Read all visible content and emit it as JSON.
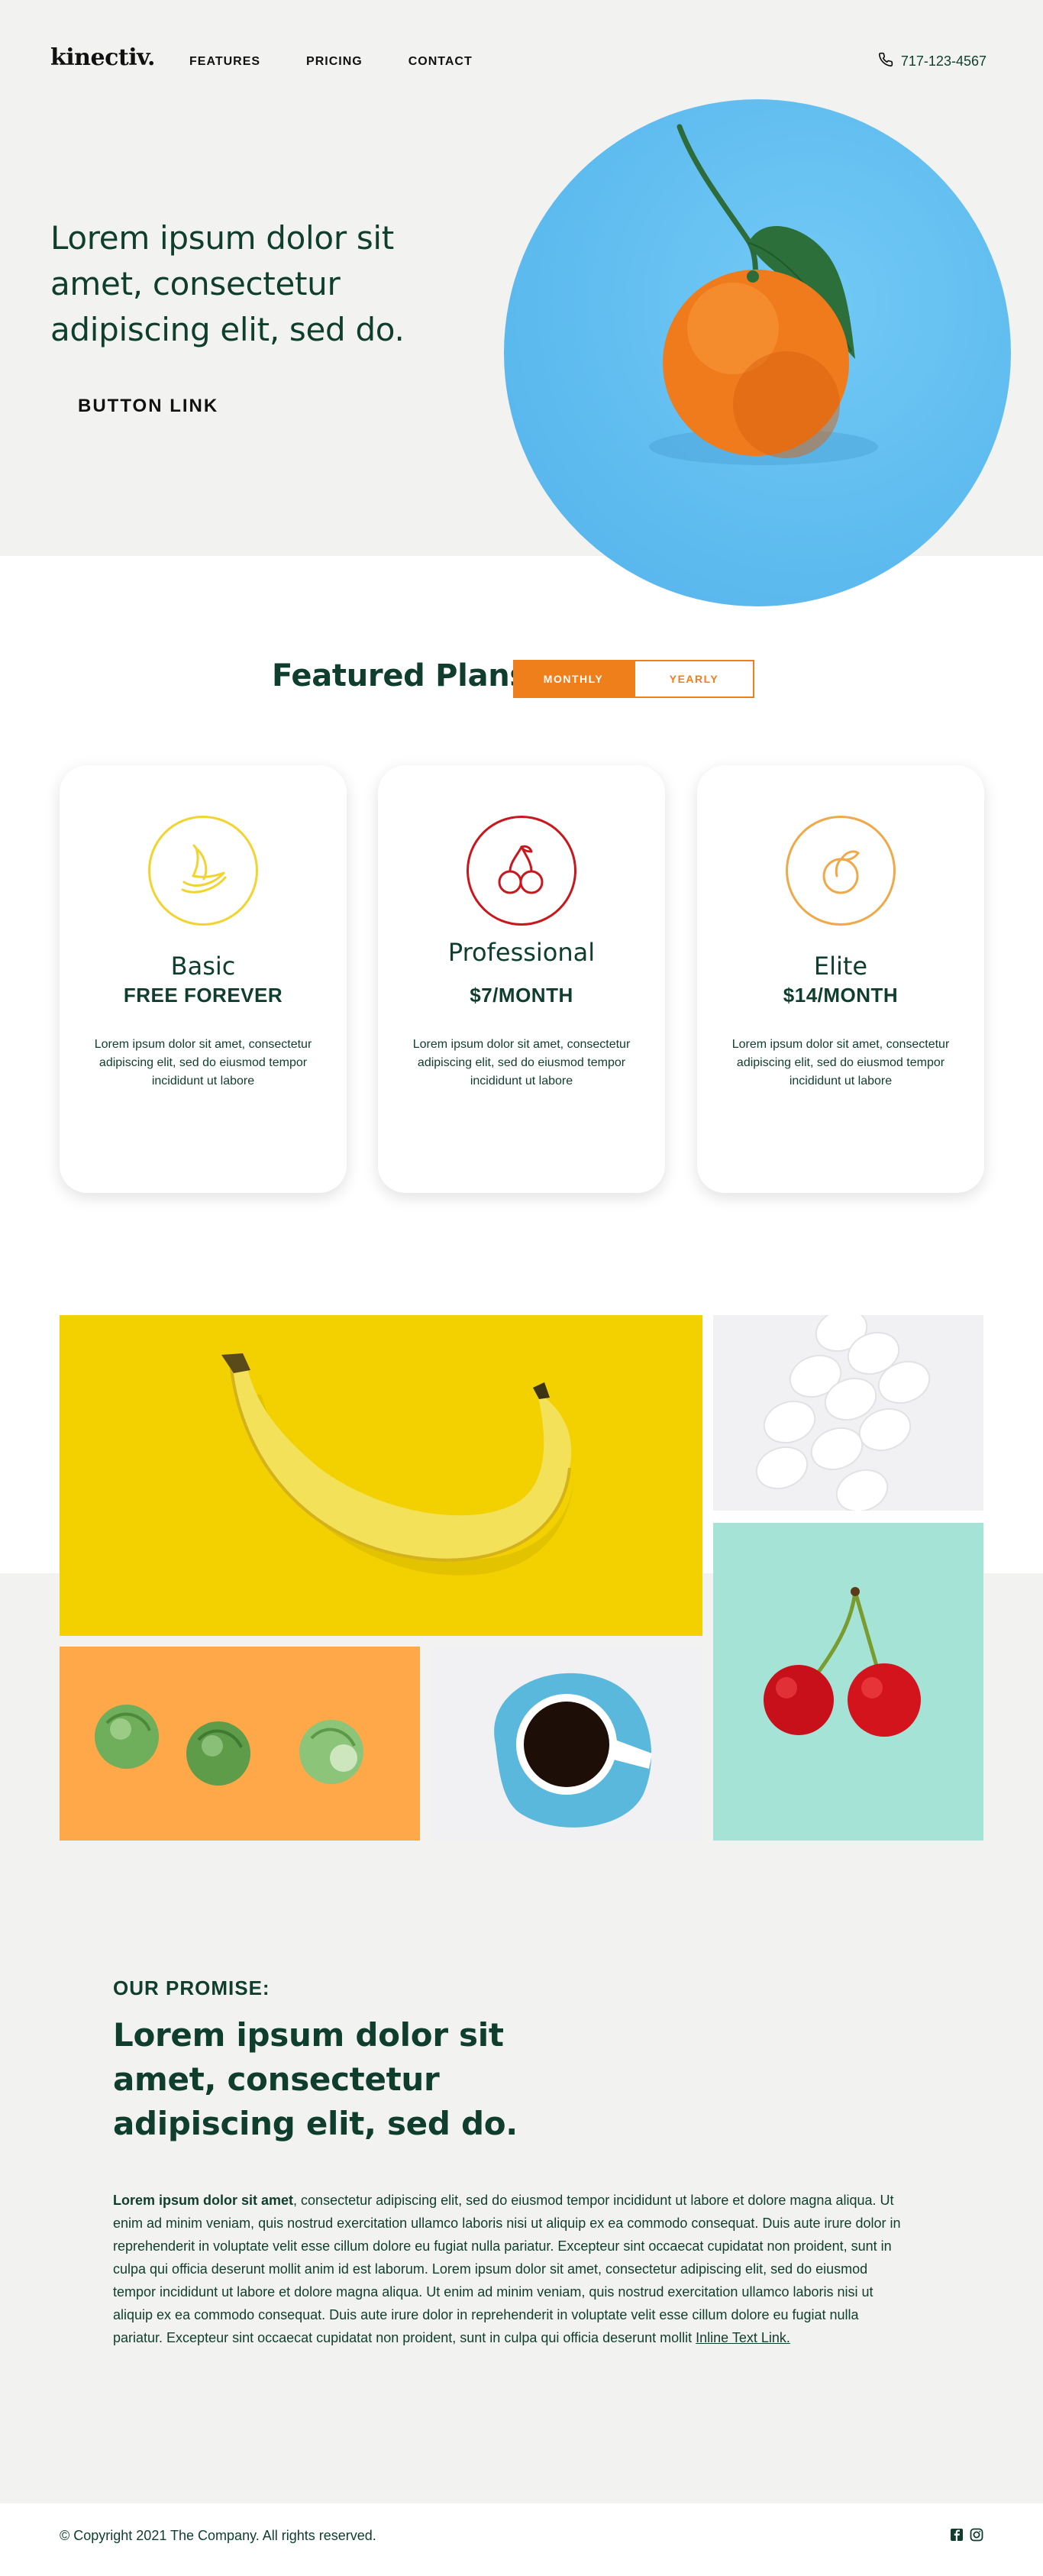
{
  "header": {
    "logo": "kinectiv.",
    "nav": [
      "FEATURES",
      "PRICING",
      "CONTACT"
    ],
    "phone": "717-123-4567"
  },
  "hero": {
    "headline": "Lorem ipsum dolor sit amet, consectetur adipiscing elit, sed do.",
    "button_label": "BUTTON LINK"
  },
  "plans": {
    "title": "Featured Plans",
    "toggle": {
      "monthly": "MONTHLY",
      "yearly": "YEARLY",
      "selected": "monthly"
    },
    "cards": [
      {
        "name": "Basic",
        "price": "FREE FOREVER",
        "desc": "Lorem ipsum dolor sit amet, consectetur adipiscing elit, sed do eiusmod tempor incididunt ut labore",
        "icon": "banana-icon",
        "color": "#f2d431"
      },
      {
        "name": "Professional",
        "price": "$7/MONTH",
        "desc": "Lorem ipsum dolor sit amet, consectetur adipiscing elit, sed do eiusmod tempor incididunt ut labore",
        "icon": "cherries-icon",
        "color": "#c8171d"
      },
      {
        "name": "Elite",
        "price": "$14/MONTH",
        "desc": "Lorem ipsum dolor sit amet, consectetur adipiscing elit, sed do eiusmod tempor incididunt ut labore",
        "icon": "peach-icon",
        "color": "#f0a94a"
      }
    ]
  },
  "promise": {
    "label": "OUR PROMISE:",
    "headline": "Lorem ipsum dolor sit amet, consectetur adipiscing elit, sed do.",
    "body_lead": "Lorem ipsum dolor sit amet",
    "body_text": ", consectetur adipiscing elit, sed do eiusmod tempor incididunt ut labore et dolore magna aliqua. Ut enim ad minim veniam, quis nostrud exercitation ullamco laboris nisi ut aliquip ex ea commodo consequat. Duis aute irure dolor in reprehenderit in voluptate velit esse cillum dolore eu fugiat nulla pariatur. Excepteur sint occaecat cupidatat non proident, sunt in culpa qui officia deserunt mollit anim id est laborum. Lorem ipsum dolor sit amet, consectetur adipiscing elit, sed do eiusmod tempor incididunt ut labore et dolore magna aliqua. Ut enim ad minim veniam, quis nostrud exercitation ullamco laboris nisi ut aliquip ex ea commodo consequat. Duis aute irure dolor in reprehenderit in voluptate velit esse cillum dolore eu fugiat nulla pariatur. Excepteur sint occaecat cupidatat non proident, sunt in culpa qui officia deserunt mollit ",
    "link_text": "Inline Text Link."
  },
  "footer": {
    "copyright": "© Copyright 2021 The Company. All rights reserved.",
    "social": [
      "facebook-icon",
      "instagram-icon"
    ]
  },
  "colors": {
    "accent": "#ef7f1a",
    "text_dark": "#0f3d2e",
    "light_bg": "#f2f2f0",
    "sky": "#5bb9ee"
  }
}
